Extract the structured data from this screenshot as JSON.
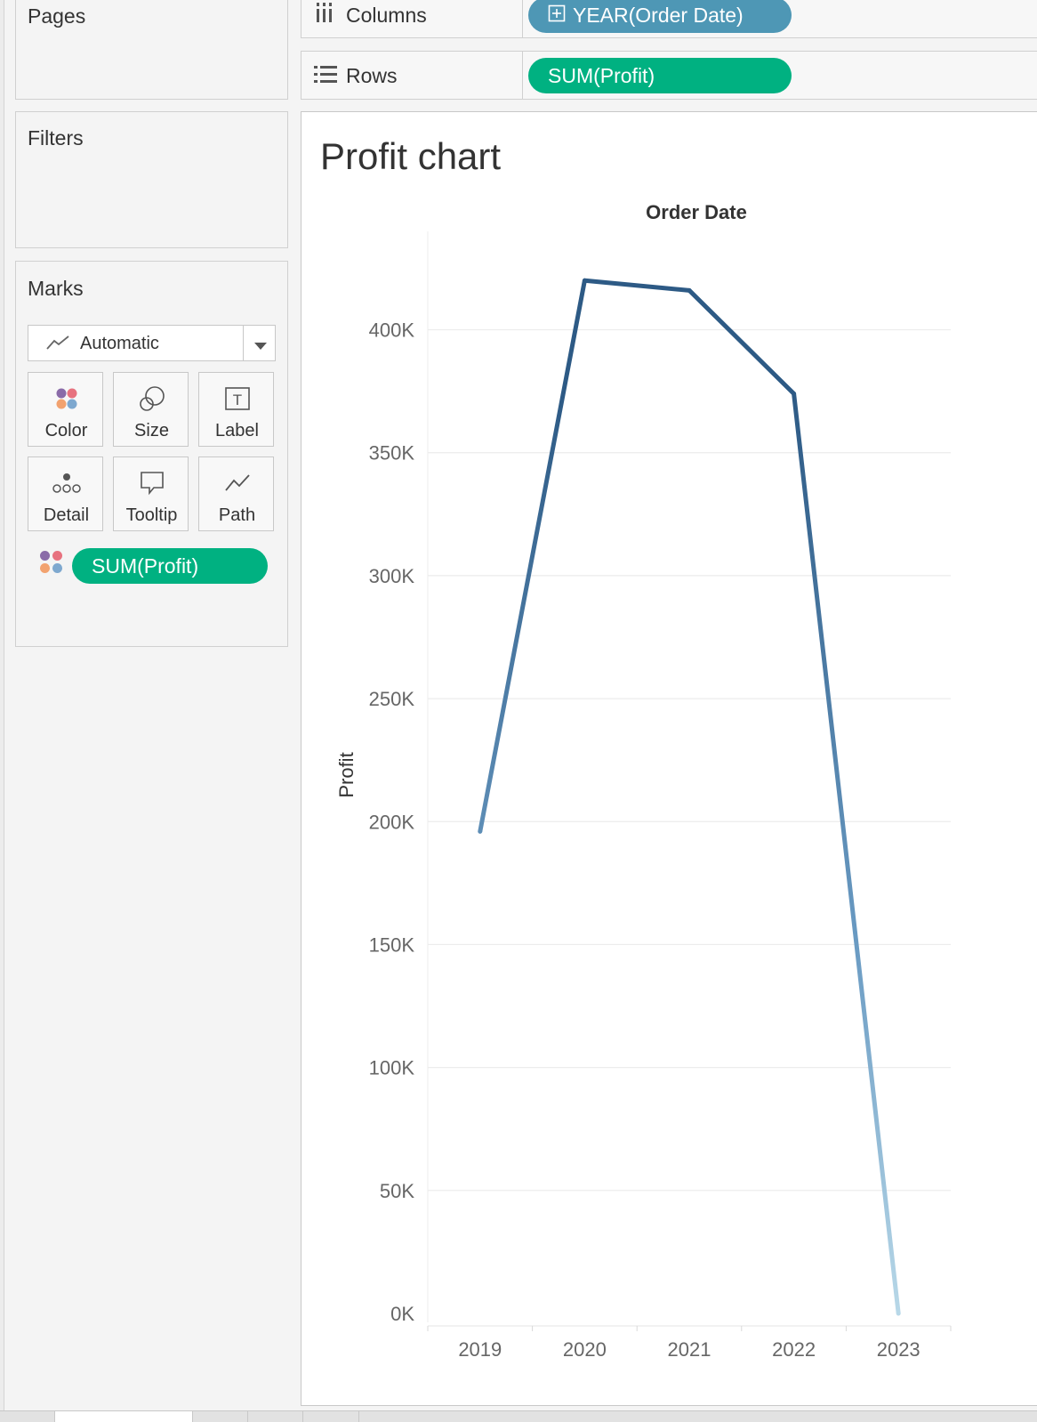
{
  "panels": {
    "pages_title": "Pages",
    "filters_title": "Filters",
    "marks_title": "Marks"
  },
  "marks": {
    "mark_type": "Automatic",
    "cards": [
      {
        "label": "Color",
        "icon": "color-dots-icon"
      },
      {
        "label": "Size",
        "icon": "size-circles-icon"
      },
      {
        "label": "Label",
        "icon": "text-label-icon"
      },
      {
        "label": "Detail",
        "icon": "detail-dots-icon"
      },
      {
        "label": "Tooltip",
        "icon": "tooltip-bubble-icon"
      },
      {
        "label": "Path",
        "icon": "path-line-icon"
      }
    ],
    "color_pill": "SUM(Profit)"
  },
  "shelves": {
    "columns_label": "Columns",
    "columns_pill": "YEAR(Order Date)",
    "rows_label": "Rows",
    "rows_pill": "SUM(Profit)"
  },
  "view": {
    "title": "Profit chart"
  },
  "colors": {
    "pill_green": "#00b181",
    "pill_blue": "#4e97b5",
    "line_dark": "#2d5a85",
    "line_light": "#b8d8e8"
  },
  "chart_data": {
    "type": "line",
    "title": "Profit chart",
    "xlabel": "Order Date",
    "ylabel": "Profit",
    "categories": [
      "2019",
      "2020",
      "2021",
      "2022",
      "2023"
    ],
    "series": [
      {
        "values": [
          196000,
          420000,
          416000,
          374000,
          0
        ]
      }
    ],
    "ylim": [
      0,
      440000
    ],
    "yticks": [
      0,
      50000,
      100000,
      150000,
      200000,
      250000,
      300000,
      350000,
      400000
    ],
    "ytick_labels": [
      "0K",
      "50K",
      "100K",
      "150K",
      "200K",
      "250K",
      "300K",
      "350K",
      "400K"
    ],
    "grid": true,
    "color_encoding": "SUM(Profit) gradient, light blue (low) to dark blue (high)"
  }
}
